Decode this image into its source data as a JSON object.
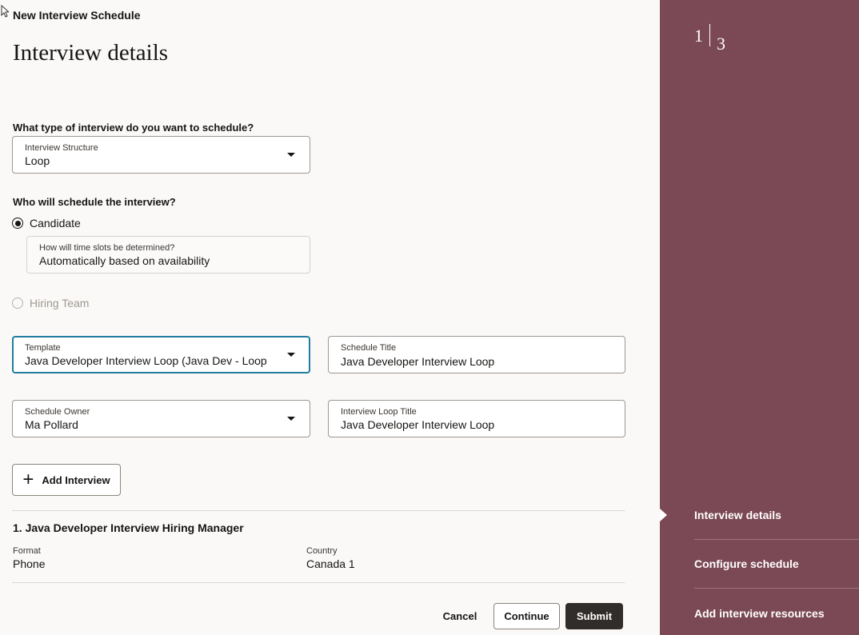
{
  "app_title": "New Interview Schedule",
  "page_title": "Interview details",
  "q_type": "What type of interview do you want to schedule?",
  "structure": {
    "label": "Interview Structure",
    "value": "Loop"
  },
  "q_scheduler": "Who will schedule the interview?",
  "radio_candidate": "Candidate",
  "timeslots": {
    "label": "How will time slots be determined?",
    "value": "Automatically based on availability"
  },
  "radio_hiring": "Hiring Team",
  "template": {
    "label": "Template",
    "value": "Java Developer Interview Loop (Java Dev - Loop"
  },
  "schedule_title": {
    "label": "Schedule Title",
    "value": "Java Developer Interview Loop"
  },
  "schedule_owner": {
    "label": "Schedule Owner",
    "value": "Ma Pollard"
  },
  "loop_title": {
    "label": "Interview Loop Title",
    "value": "Java Developer Interview Loop"
  },
  "add_interview": "Add Interview",
  "interview": {
    "title": "1. Java Developer Interview Hiring Manager",
    "format_label": "Format",
    "format_value": "Phone",
    "country_label": "Country",
    "country_value": "Canada 1"
  },
  "actions": {
    "cancel": "Cancel",
    "continue": "Continue",
    "submit": "Submit"
  },
  "progress": {
    "current": "1",
    "total": "3"
  },
  "steps": [
    "Interview details",
    "Configure schedule",
    "Add interview resources"
  ],
  "colors": {
    "side_panel": "#7b4855",
    "focus": "#227e9e",
    "primary_button": "#312d2a"
  }
}
